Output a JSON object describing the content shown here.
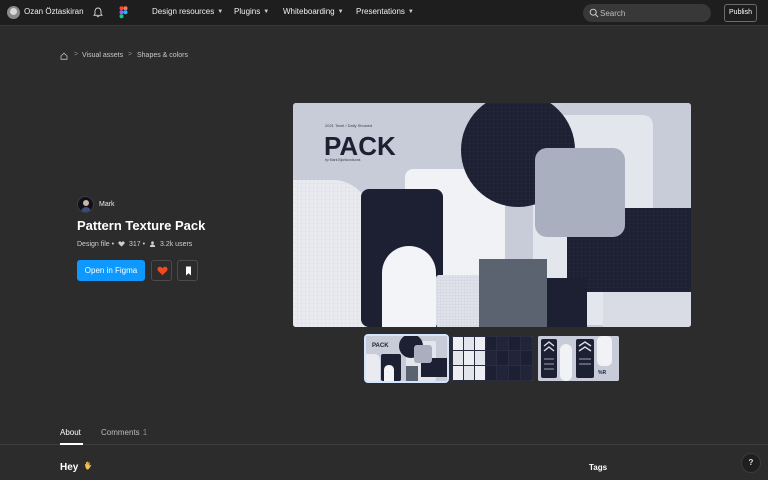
{
  "topbar": {
    "user_name": "Ozan Öztaskiran",
    "nav": [
      {
        "label": "Design resources"
      },
      {
        "label": "Plugins"
      },
      {
        "label": "Whiteboarding"
      },
      {
        "label": "Presentations"
      }
    ],
    "search_placeholder": "Search",
    "publish_label": "Publish",
    "icons": [
      "user-avatar",
      "bell-icon",
      "figma-logo",
      "search-icon",
      "chevron-down-icon"
    ]
  },
  "breadcrumb": {
    "items": [
      "Visual assets",
      "Shapes & colors"
    ],
    "separator": ">"
  },
  "file": {
    "author": "Mark",
    "title": "Pattern Texture Pack",
    "type": "Design file",
    "bullet": "•",
    "likes": "317",
    "users": "3.2k users",
    "open_label": "Open in Figma"
  },
  "hero": {
    "small_caption": "2021 Texel / Daily Showed",
    "pack_text": "PACK",
    "sub_caption": "by Mark Bjorklundsons"
  },
  "thumbnails": [
    {
      "label": "PACK"
    },
    {
      "label": ""
    },
    {
      "label": ""
    }
  ],
  "tabs": {
    "about_label": "About",
    "comments_label": "Comments",
    "comments_count": "1"
  },
  "content": {
    "greeting": "Hey",
    "tags_label": "Tags",
    "help_label": "?"
  },
  "colors": {
    "background": "#2c2c2c",
    "topbar": "#1e1e1e",
    "accent_blue": "#0d99ff",
    "heart_red": "#f24822",
    "hero_navy": "#1d1f33",
    "hero_light": "#c8ccd8"
  }
}
